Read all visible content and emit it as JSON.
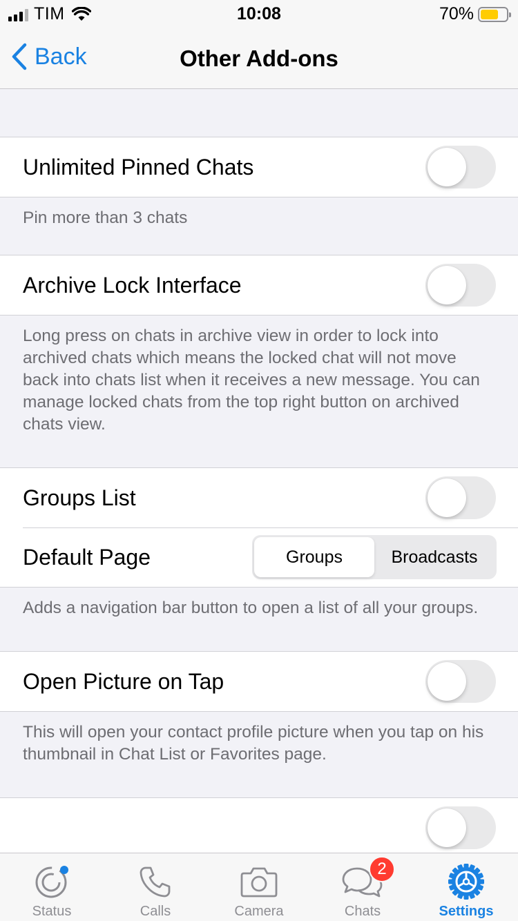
{
  "status_bar": {
    "carrier": "TIM",
    "time": "10:08",
    "battery_percent": "70%",
    "battery_level": 0.7,
    "battery_color": "#ffcc00"
  },
  "nav": {
    "back_label": "Back",
    "title": "Other Add-ons",
    "accent_color": "#1a82e2"
  },
  "sections": {
    "pinned": {
      "label": "Unlimited Pinned Chats",
      "enabled": false,
      "footer": "Pin more than 3 chats"
    },
    "archive": {
      "label": "Archive Lock Interface",
      "enabled": false,
      "footer": "Long press on chats in archive view in order to lock into archived chats which means the locked chat will not move back into chats list when it receives a new message. You can manage locked chats from the top right button on archived chats view."
    },
    "groups": {
      "label": "Groups List",
      "enabled": false,
      "default_page_label": "Default Page",
      "segments": [
        "Groups",
        "Broadcasts"
      ],
      "selected_segment": "Groups",
      "footer": "Adds a navigation bar button to open a list of all your groups."
    },
    "open_picture": {
      "label": "Open Picture on Tap",
      "enabled": false,
      "footer": "This will open your contact profile picture when you tap on his thumbnail in Chat List or Favorites page."
    }
  },
  "tab_bar": {
    "tabs": [
      {
        "label": "Status",
        "icon": "status-icon"
      },
      {
        "label": "Calls",
        "icon": "phone-icon"
      },
      {
        "label": "Camera",
        "icon": "camera-icon"
      },
      {
        "label": "Chats",
        "icon": "chat-bubbles-icon",
        "badge": "2"
      },
      {
        "label": "Settings",
        "icon": "gear-icon",
        "active": true
      }
    ]
  }
}
